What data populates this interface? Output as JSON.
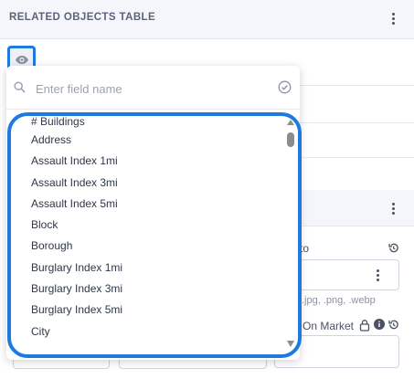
{
  "top_panel": {
    "title": "RELATED OBJECTS TABLE",
    "menu_icon": "kebab-menu-icon"
  },
  "eye_toggle": {
    "icon": "eye-icon"
  },
  "dropdown": {
    "search": {
      "placeholder": "Enter field name",
      "value": "",
      "icon": "search-icon",
      "confirm_icon": "check-circle-icon"
    },
    "items": [
      "# Buildings",
      "Address",
      "Assault Index 1mi",
      "Assault Index 3mi",
      "Assault Index 5mi",
      "Block",
      "Borough",
      "Burglary Index 1mi",
      "Burglary Index 3mi",
      "Burglary Index 5mi",
      "City"
    ]
  },
  "background": {
    "second_panel_menu_icon": "kebab-menu-icon",
    "field_label_fragment": "to",
    "file_hint": ".jpg, .png, .webp",
    "on_market_label": "On Market",
    "history_icon": "history-icon",
    "lock_icon": "lock-icon",
    "info_icon": "info-icon"
  }
}
